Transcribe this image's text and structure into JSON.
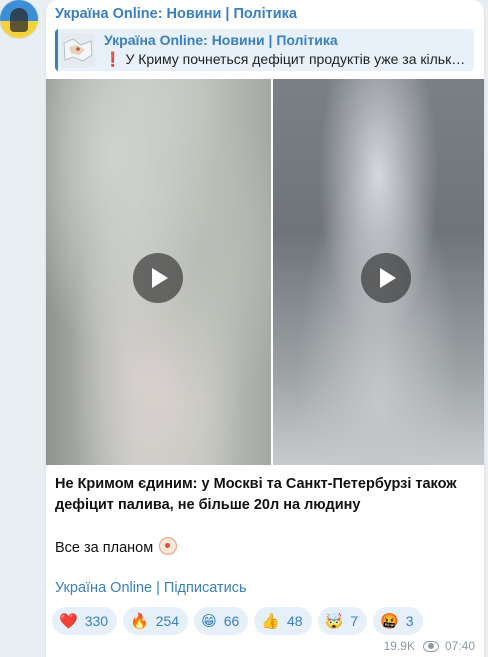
{
  "channel": {
    "name": "Україна Online: Новини | Політика",
    "avatar_icon": "ukraine-flag-avatar-icon"
  },
  "reply": {
    "title": "Україна Online: Новини | Політика",
    "exclamation": "❗",
    "text": "У Криму почнеться дефіцит продуктів уже за кільк…",
    "thumbnail_icon": "map-thumbnail-icon"
  },
  "media": {
    "videos": [
      {
        "play_icon": "play-icon"
      },
      {
        "play_icon": "play-icon"
      }
    ]
  },
  "post": {
    "headline": "Не Кримом єдиним: у Москві та Санкт-Петербурзі також дефіцит палива, не більше 20л на людину",
    "body": "Все за планом",
    "body_emoji_icon": "clown-face-icon",
    "subscribe_link": "Україна Online | Підписатись"
  },
  "reactions": [
    {
      "emoji": "❤️",
      "icon": "red-heart-icon",
      "count": "330"
    },
    {
      "emoji": "🔥",
      "icon": "fire-icon",
      "count": "254"
    },
    {
      "emoji": "😁",
      "icon": "grinning-face-icon",
      "count": "66"
    },
    {
      "emoji": "👍",
      "icon": "thumbs-up-icon",
      "count": "48"
    },
    {
      "emoji": "🤯",
      "icon": "exploding-head-icon",
      "count": "7"
    },
    {
      "emoji": "🤬",
      "icon": "cursing-face-icon",
      "count": "3"
    }
  ],
  "meta": {
    "views": "19.9K",
    "views_icon": "eye-icon",
    "time": "07:40"
  },
  "colors": {
    "accent": "#3a7fc0",
    "reaction_bg": "#e6f0fa",
    "chat_bg": "#e9eef2"
  }
}
